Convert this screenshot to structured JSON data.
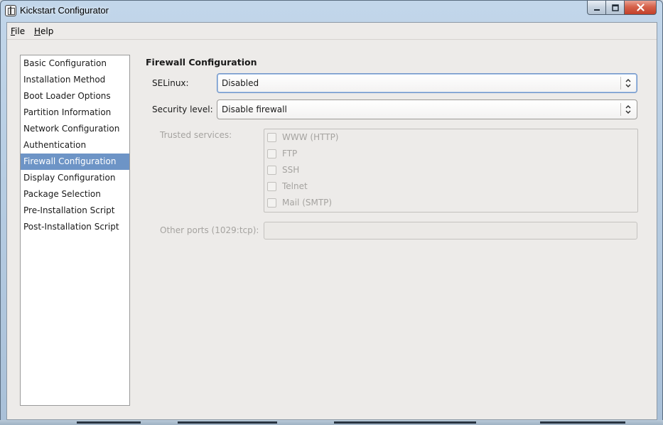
{
  "window": {
    "title": "Kickstart Configurator"
  },
  "menu": {
    "file": {
      "mnemonic": "F",
      "rest": "ile"
    },
    "help": {
      "mnemonic": "H",
      "rest": "elp"
    }
  },
  "sidebar": {
    "selected_index": 6,
    "items": [
      "Basic Configuration",
      "Installation Method",
      "Boot Loader Options",
      "Partition Information",
      "Network Configuration",
      "Authentication",
      "Firewall Configuration",
      "Display Configuration",
      "Package Selection",
      "Pre-Installation Script",
      "Post-Installation Script"
    ]
  },
  "firewall": {
    "title": "Firewall Configuration",
    "selinux": {
      "label": "SELinux:",
      "value": "Disabled"
    },
    "security_level": {
      "label": "Security level:",
      "value": "Disable firewall"
    },
    "trusted_services": {
      "label": "Trusted services:",
      "items": [
        {
          "label": "WWW (HTTP)",
          "checked": false
        },
        {
          "label": "FTP",
          "checked": false
        },
        {
          "label": "SSH",
          "checked": false
        },
        {
          "label": "Telnet",
          "checked": false
        },
        {
          "label": "Mail (SMTP)",
          "checked": false
        }
      ]
    },
    "other_ports": {
      "label": "Other ports (1029:tcp):",
      "value": ""
    }
  },
  "colors": {
    "selection": "#6d94c6",
    "panel": "#edebe9",
    "disabled_text": "#a5a3a0",
    "close_button": "#c2402a"
  }
}
